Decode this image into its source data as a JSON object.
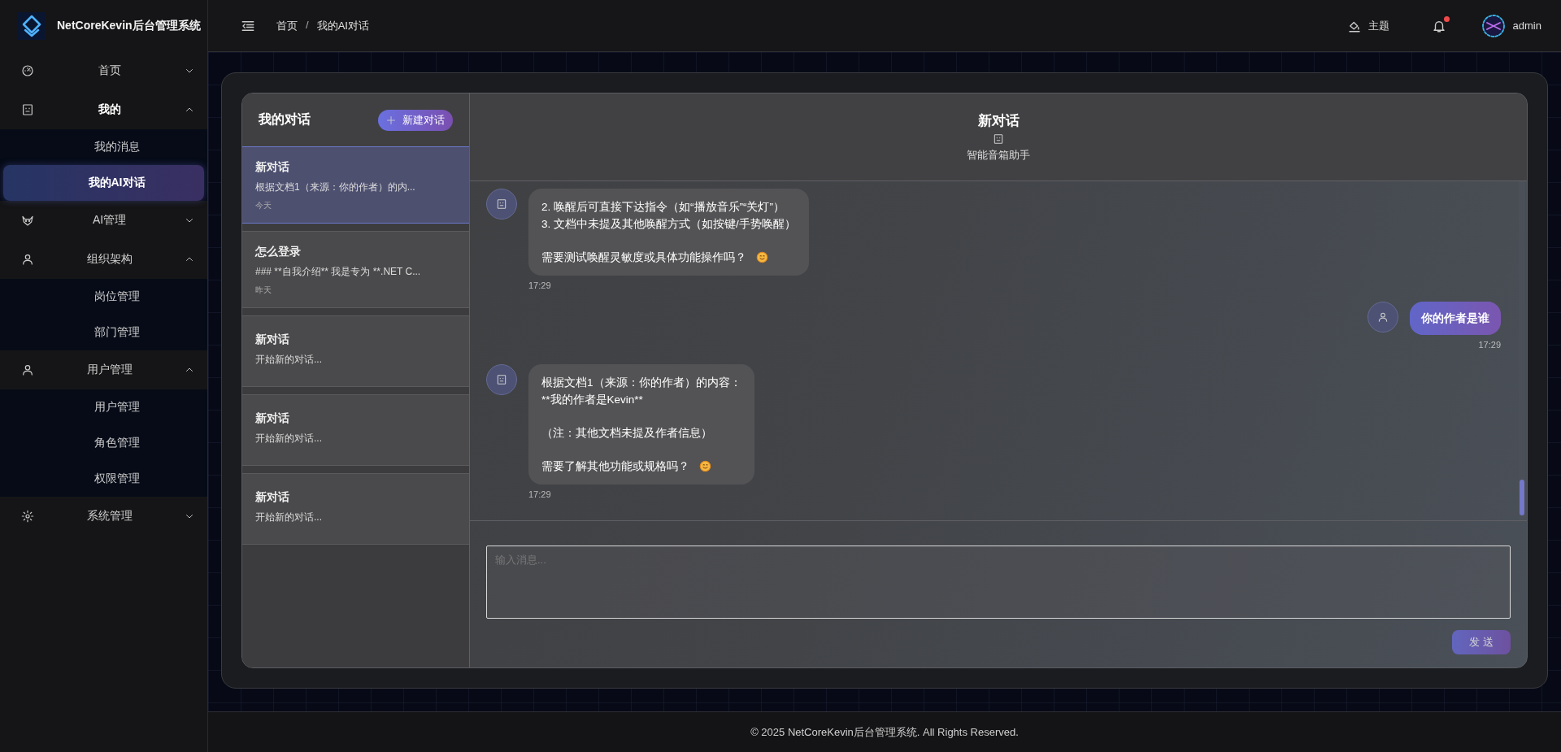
{
  "sidebar": {
    "brand": "NetCoreKevin后台管理系统",
    "menu": [
      {
        "label": "首页",
        "expanded": false
      },
      {
        "label": "我的",
        "expanded": true,
        "children": [
          {
            "label": "我的消息",
            "selected": false
          },
          {
            "label": "我的AI对话",
            "selected": true
          }
        ]
      },
      {
        "label": "AI管理",
        "expanded": false
      },
      {
        "label": "组织架构",
        "expanded": true,
        "children": [
          {
            "label": "岗位管理",
            "selected": false
          },
          {
            "label": "部门管理",
            "selected": false
          }
        ]
      },
      {
        "label": "用户管理",
        "expanded": true,
        "children": [
          {
            "label": "用户管理",
            "selected": false
          },
          {
            "label": "角色管理",
            "selected": false
          },
          {
            "label": "权限管理",
            "selected": false
          }
        ]
      },
      {
        "label": "系统管理",
        "expanded": false
      }
    ]
  },
  "header": {
    "breadcrumb": [
      "首页",
      "我的AI对话"
    ],
    "breadcrumb_separator": "/",
    "theme_label": "主题",
    "notification_dot": true,
    "username": "admin"
  },
  "conversations": {
    "title": "我的对话",
    "new_button": "新建对话",
    "items": [
      {
        "title": "新对话",
        "preview": "根据文档1（来源：你的作者）的内...",
        "date": "今天",
        "selected": true
      },
      {
        "title": "怎么登录",
        "preview": "### **自我介绍** 我是专为 **.NET C...",
        "date": "昨天",
        "selected": false
      },
      {
        "title": "新对话",
        "preview": "开始新的对话...",
        "selected": false
      },
      {
        "title": "新对话",
        "preview": "开始新的对话...",
        "selected": false
      },
      {
        "title": "新对话",
        "preview": "开始新的对话...",
        "selected": false
      }
    ]
  },
  "chat": {
    "title": "新对话",
    "assistant": "智能音箱助手",
    "messages": [
      {
        "kind": "assistant",
        "paragraphs": [
          [
            "2. 唤醒后可直接下达指令（如“播放音乐”“关灯”）",
            "3. 文档中未提及其他唤醒方式（如按键/手势唤醒）"
          ],
          [
            "需要测试唤醒灵敏度或具体功能操作吗？"
          ]
        ],
        "smiley": true,
        "time": "17:29"
      },
      {
        "kind": "user",
        "paragraphs": [
          [
            "你的作者是谁"
          ]
        ],
        "time": "17:29"
      },
      {
        "kind": "assistant",
        "paragraphs": [
          [
            "根据文档1（来源：你的作者）的内容：",
            "**我的作者是Kevin**"
          ],
          [
            "（注：其他文档未提及作者信息）"
          ],
          [
            "需要了解其他功能或规格吗？"
          ]
        ],
        "smiley": true,
        "time": "17:29"
      }
    ],
    "input": {
      "placeholder": "输入消息..."
    },
    "send_button": {
      "label": "发 送",
      "disabled": true
    }
  },
  "footer": "© 2025 NetCoreKevin后台管理系统. All Rights Reserved."
}
